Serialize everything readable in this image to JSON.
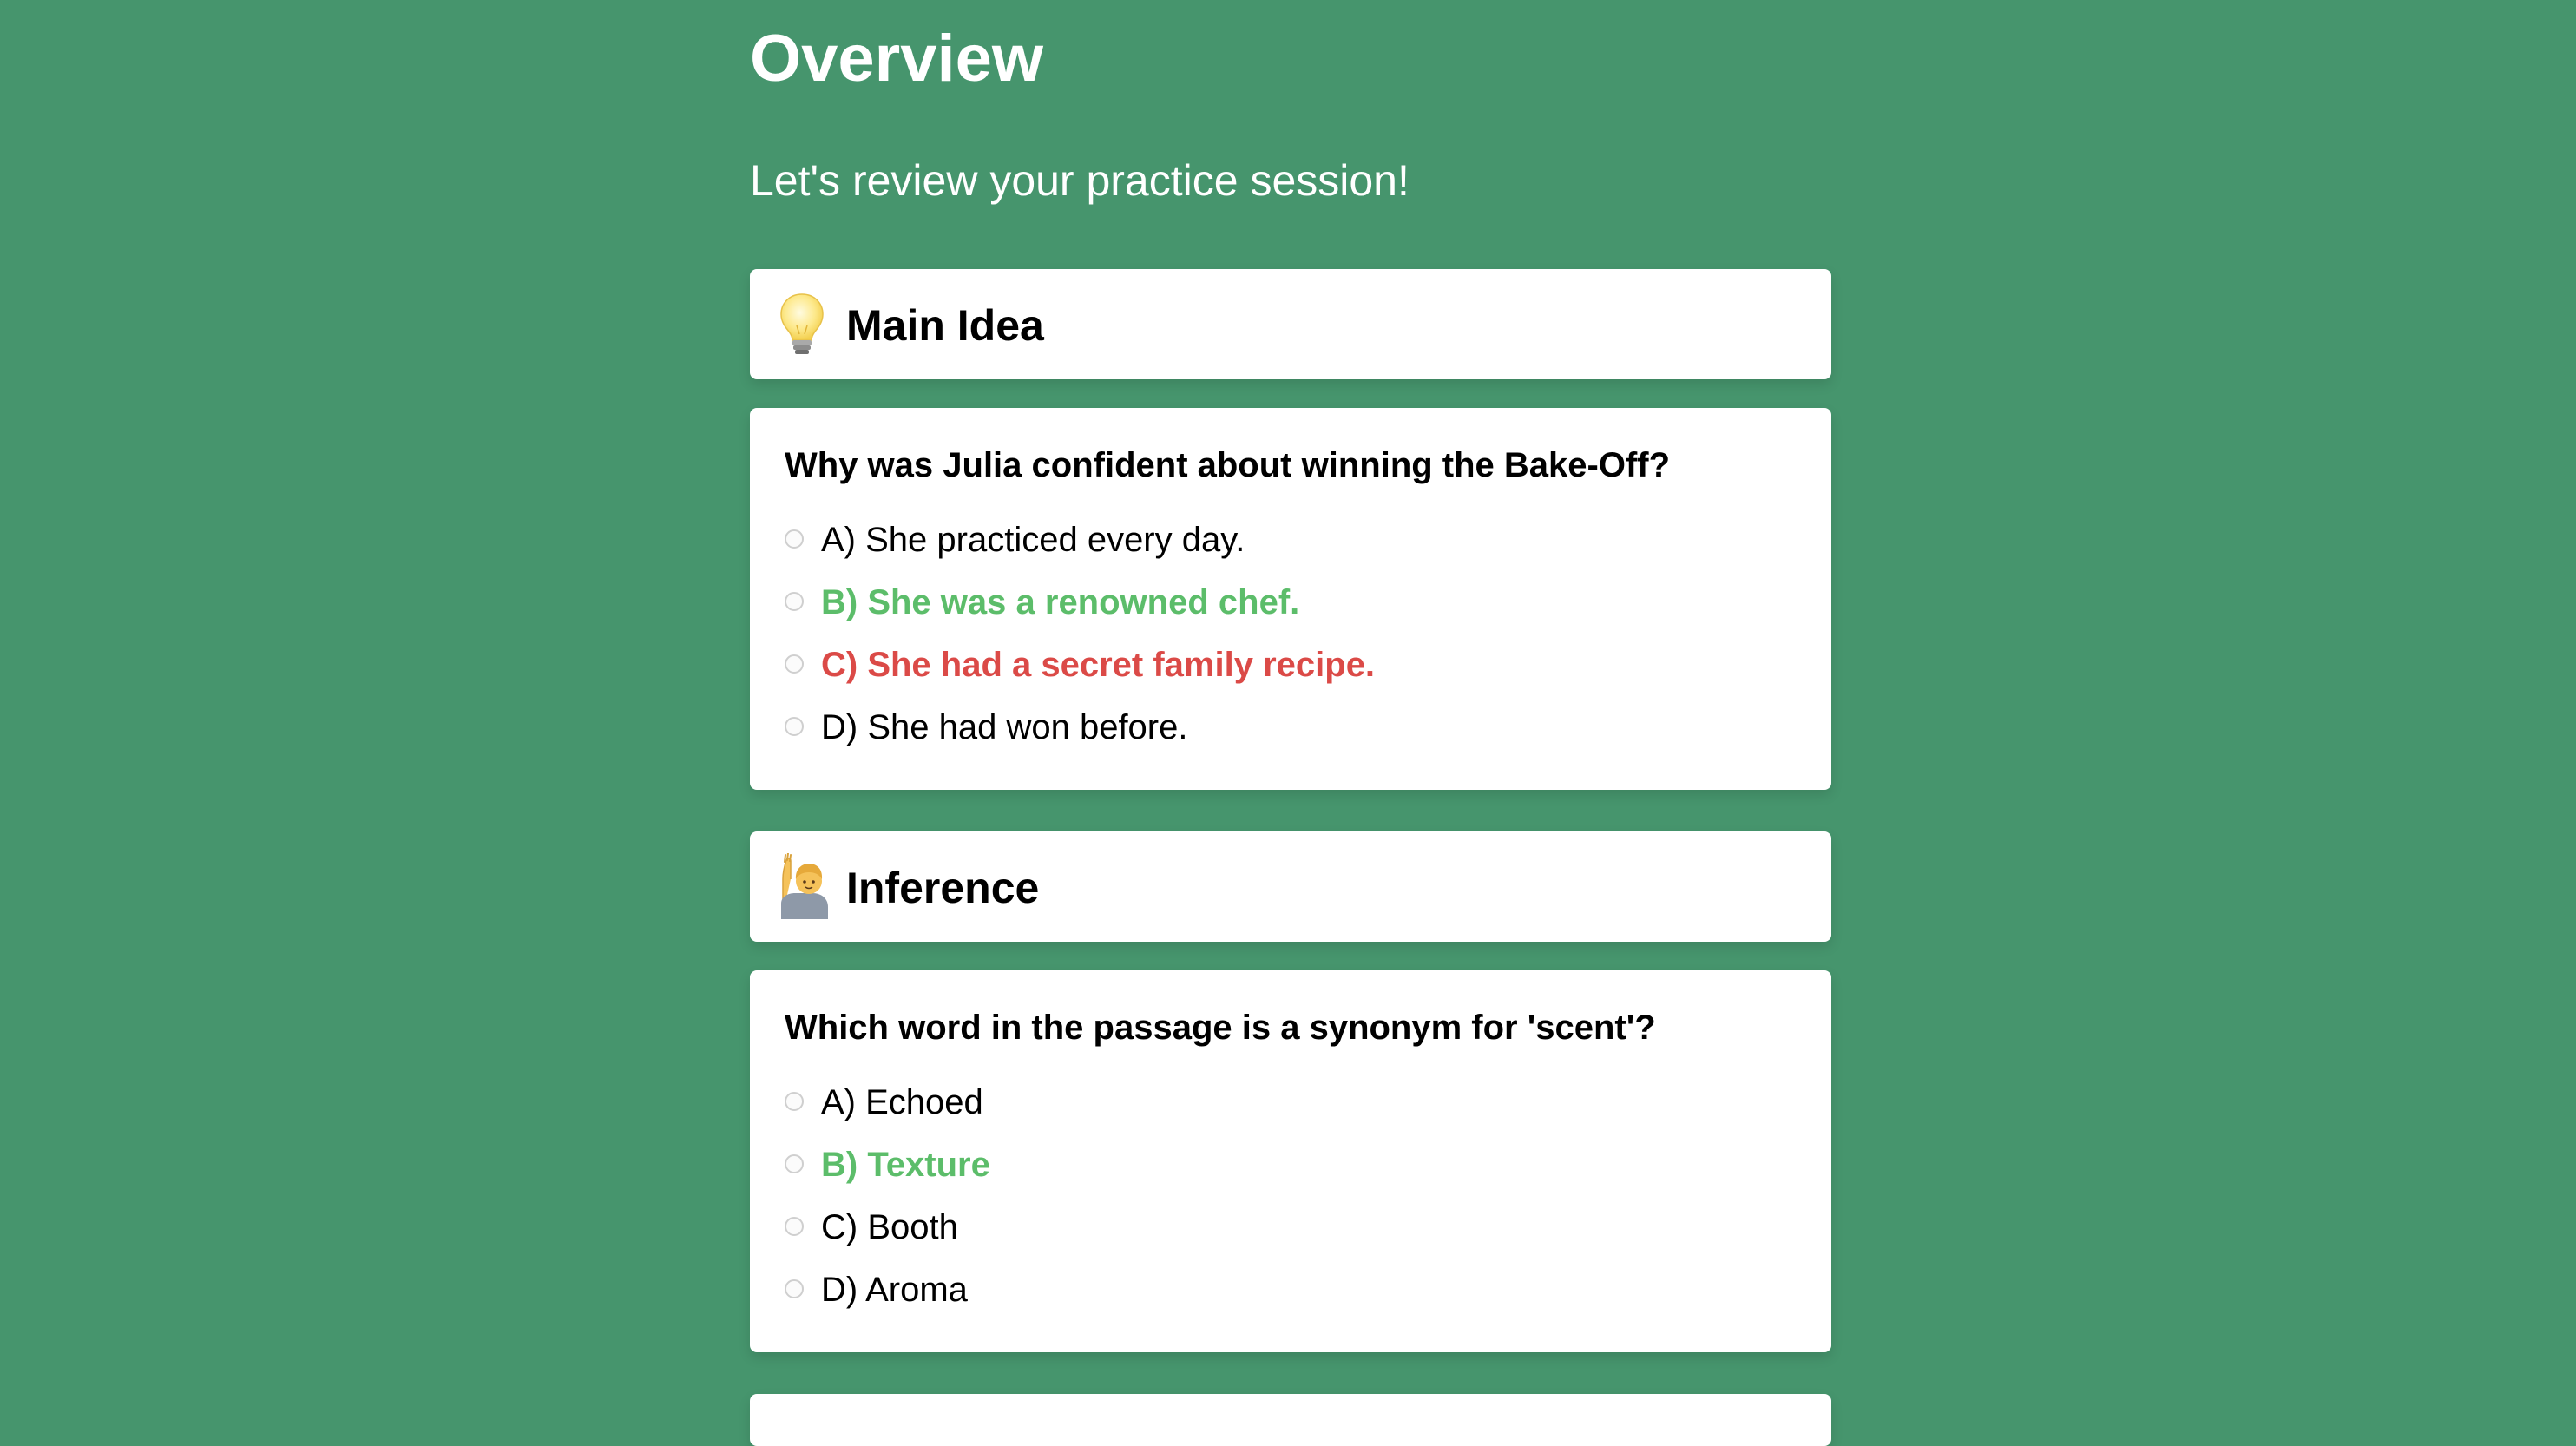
{
  "header": {
    "title": "Overview",
    "subtitle": "Let's review your practice session!"
  },
  "sections": [
    {
      "title": "Main Idea",
      "icon": "light-bulb-icon",
      "question": "Why was Julia confident about winning the Bake-Off?",
      "options": [
        {
          "label": "A) She practiced every day.",
          "state": "neutral"
        },
        {
          "label": "B) She was a renowned chef.",
          "state": "correct"
        },
        {
          "label": "C) She had a secret family recipe.",
          "state": "incorrect"
        },
        {
          "label": "D) She had won before.",
          "state": "neutral"
        }
      ]
    },
    {
      "title": "Inference",
      "icon": "person-raising-hand-icon",
      "question": "Which word in the passage is a synonym for 'scent'?",
      "options": [
        {
          "label": "A) Echoed",
          "state": "neutral"
        },
        {
          "label": "B) Texture",
          "state": "correct"
        },
        {
          "label": "C) Booth",
          "state": "neutral"
        },
        {
          "label": "D) Aroma",
          "state": "neutral"
        }
      ]
    }
  ],
  "colors": {
    "background": "#46956d",
    "correct": "#5cbd6a",
    "incorrect": "#db4a47"
  }
}
